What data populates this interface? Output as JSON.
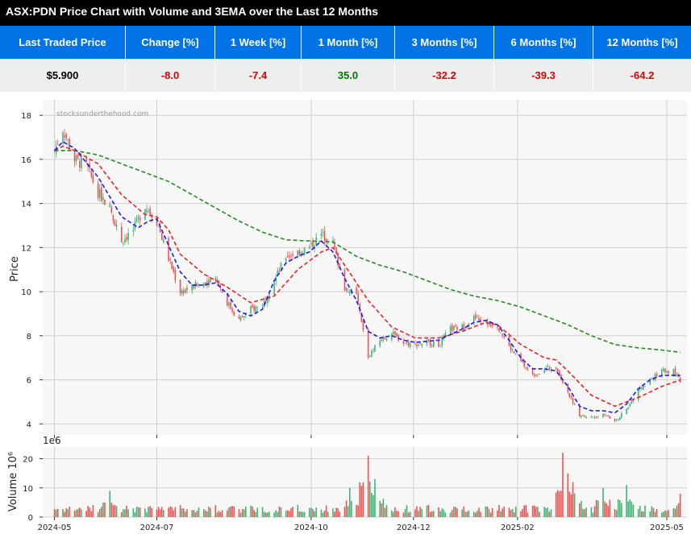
{
  "page": {
    "title": "ASX:PDN Price Chart with Volume and 3EMA over the Last 12 Months"
  },
  "stats": {
    "headers": [
      "Last Traded Price",
      "Change [%]",
      "1 Week [%]",
      "1 Month [%]",
      "3 Months [%]",
      "6 Months [%]",
      "12 Months [%]"
    ],
    "values": [
      "$5.900",
      "-8.0",
      "-7.4",
      "35.0",
      "-32.2",
      "-39.3",
      "-64.2"
    ],
    "value_colors": [
      "#000000",
      "#dd0000",
      "#dd0000",
      "#007700",
      "#dd0000",
      "#dd0000",
      "#dd0000"
    ]
  },
  "colors": {
    "up": "#3cb371",
    "down": "#f05050",
    "ema_fast": "#1a1aff",
    "ema_mid": "#ee2222",
    "ema_slow": "#228b22",
    "grid": "#d0d0d0",
    "header_bg": "#0073e6"
  },
  "chart_data": {
    "type": "candlestick",
    "watermark": "stocksunderthehood.com",
    "price_panel": {
      "ylabel": "Price",
      "ylim": [
        3.5,
        18.7
      ],
      "y_ticks": [
        4,
        6,
        8,
        10,
        12,
        14,
        16,
        18
      ],
      "grid": true
    },
    "volume_panel": {
      "ylabel": "Volume  10⁶",
      "offset_label": "1e6",
      "ylim": [
        0,
        24
      ],
      "y_ticks": [
        0,
        10,
        20
      ],
      "grid": true
    },
    "x_range": [
      "2024-04-24",
      "2025-05-13"
    ],
    "x_ticks": [
      "2024-05",
      "2024-07",
      "2024-10",
      "2024-12",
      "2025-02",
      "2025-05"
    ],
    "x_tick_dates": [
      "2024-05-01",
      "2024-07-01",
      "2024-10-01",
      "2024-12-01",
      "2025-02-01",
      "2025-05-01"
    ],
    "price_anchors": [
      [
        "2024-05-01",
        16.4
      ],
      [
        "2024-05-06",
        17.4
      ],
      [
        "2024-05-13",
        16.0
      ],
      [
        "2024-05-20",
        15.7
      ],
      [
        "2024-05-27",
        14.5
      ],
      [
        "2024-06-03",
        13.8
      ],
      [
        "2024-06-10",
        12.3
      ],
      [
        "2024-06-17",
        12.8
      ],
      [
        "2024-06-24",
        13.9
      ],
      [
        "2024-07-01",
        13.2
      ],
      [
        "2024-07-08",
        11.5
      ],
      [
        "2024-07-15",
        10.0
      ],
      [
        "2024-07-22",
        10.2
      ],
      [
        "2024-07-29",
        10.4
      ],
      [
        "2024-08-05",
        10.7
      ],
      [
        "2024-08-12",
        9.5
      ],
      [
        "2024-08-19",
        8.7
      ],
      [
        "2024-08-26",
        9.2
      ],
      [
        "2024-09-02",
        9.4
      ],
      [
        "2024-09-09",
        10.5
      ],
      [
        "2024-09-16",
        11.6
      ],
      [
        "2024-09-23",
        11.8
      ],
      [
        "2024-09-30",
        12.0
      ],
      [
        "2024-10-07",
        12.6
      ],
      [
        "2024-10-14",
        12.2
      ],
      [
        "2024-10-21",
        10.2
      ],
      [
        "2024-10-28",
        9.8
      ],
      [
        "2024-11-04",
        7.0
      ],
      [
        "2024-11-11",
        7.8
      ],
      [
        "2024-11-18",
        8.1
      ],
      [
        "2024-11-25",
        7.7
      ],
      [
        "2024-12-02",
        7.6
      ],
      [
        "2024-12-09",
        7.7
      ],
      [
        "2024-12-16",
        7.6
      ],
      [
        "2024-12-23",
        8.3
      ],
      [
        "2024-12-30",
        8.4
      ],
      [
        "2025-01-06",
        8.8
      ],
      [
        "2025-01-13",
        8.6
      ],
      [
        "2025-01-20",
        8.5
      ],
      [
        "2025-01-27",
        7.5
      ],
      [
        "2025-02-03",
        6.8
      ],
      [
        "2025-02-10",
        6.2
      ],
      [
        "2025-02-17",
        6.5
      ],
      [
        "2025-02-24",
        6.6
      ],
      [
        "2025-03-03",
        5.4
      ],
      [
        "2025-03-10",
        4.4
      ],
      [
        "2025-03-17",
        4.3
      ],
      [
        "2025-03-24",
        4.5
      ],
      [
        "2025-03-31",
        4.1
      ],
      [
        "2025-04-07",
        4.7
      ],
      [
        "2025-04-14",
        5.5
      ],
      [
        "2025-04-21",
        6.0
      ],
      [
        "2025-04-28",
        6.4
      ],
      [
        "2025-05-05",
        6.4
      ],
      [
        "2025-05-09",
        5.9
      ]
    ],
    "ema_fast": [
      [
        "2024-05-01",
        16.4
      ],
      [
        "2024-05-06",
        16.8
      ],
      [
        "2024-05-13",
        16.5
      ],
      [
        "2024-05-27",
        15.2
      ],
      [
        "2024-06-10",
        13.4
      ],
      [
        "2024-06-20",
        12.9
      ],
      [
        "2024-06-26",
        13.2
      ],
      [
        "2024-07-01",
        13.3
      ],
      [
        "2024-07-08",
        12.1
      ],
      [
        "2024-07-15",
        10.9
      ],
      [
        "2024-07-22",
        10.3
      ],
      [
        "2024-07-29",
        10.3
      ],
      [
        "2024-08-05",
        10.4
      ],
      [
        "2024-08-12",
        9.9
      ],
      [
        "2024-08-19",
        9.1
      ],
      [
        "2024-08-26",
        8.9
      ],
      [
        "2024-09-02",
        9.2
      ],
      [
        "2024-09-09",
        10.5
      ],
      [
        "2024-09-16",
        11.3
      ],
      [
        "2024-09-23",
        11.6
      ],
      [
        "2024-09-30",
        11.8
      ],
      [
        "2024-10-07",
        12.3
      ],
      [
        "2024-10-14",
        11.8
      ],
      [
        "2024-10-21",
        10.6
      ],
      [
        "2024-10-28",
        9.6
      ],
      [
        "2024-11-04",
        8.2
      ],
      [
        "2024-11-11",
        7.9
      ],
      [
        "2024-11-18",
        8.0
      ],
      [
        "2024-11-25",
        7.8
      ],
      [
        "2024-12-02",
        7.7
      ],
      [
        "2024-12-16",
        7.8
      ],
      [
        "2024-12-30",
        8.3
      ],
      [
        "2025-01-06",
        8.6
      ],
      [
        "2025-01-13",
        8.7
      ],
      [
        "2025-01-20",
        8.5
      ],
      [
        "2025-01-27",
        7.8
      ],
      [
        "2025-02-03",
        7.0
      ],
      [
        "2025-02-10",
        6.5
      ],
      [
        "2025-02-17",
        6.5
      ],
      [
        "2025-02-24",
        6.4
      ],
      [
        "2025-03-03",
        5.7
      ],
      [
        "2025-03-10",
        4.8
      ],
      [
        "2025-03-17",
        4.6
      ],
      [
        "2025-03-24",
        4.6
      ],
      [
        "2025-03-31",
        4.5
      ],
      [
        "2025-04-07",
        4.9
      ],
      [
        "2025-04-14",
        5.6
      ],
      [
        "2025-04-21",
        6.0
      ],
      [
        "2025-04-28",
        6.2
      ],
      [
        "2025-05-09",
        6.2
      ]
    ],
    "ema_mid": [
      [
        "2024-05-01",
        16.4
      ],
      [
        "2024-05-06",
        16.6
      ],
      [
        "2024-05-13",
        16.4
      ],
      [
        "2024-05-27",
        15.8
      ],
      [
        "2024-06-10",
        14.4
      ],
      [
        "2024-06-24",
        13.5
      ],
      [
        "2024-07-01",
        13.4
      ],
      [
        "2024-07-08",
        12.8
      ],
      [
        "2024-07-15",
        11.7
      ],
      [
        "2024-07-29",
        10.8
      ],
      [
        "2024-08-12",
        10.2
      ],
      [
        "2024-08-26",
        9.5
      ],
      [
        "2024-09-09",
        9.8
      ],
      [
        "2024-09-23",
        11.0
      ],
      [
        "2024-10-07",
        11.8
      ],
      [
        "2024-10-14",
        12.0
      ],
      [
        "2024-10-21",
        11.2
      ],
      [
        "2024-11-04",
        9.6
      ],
      [
        "2024-11-18",
        8.4
      ],
      [
        "2024-12-02",
        7.9
      ],
      [
        "2024-12-16",
        7.9
      ],
      [
        "2024-12-30",
        8.2
      ],
      [
        "2025-01-13",
        8.6
      ],
      [
        "2025-01-20",
        8.5
      ],
      [
        "2025-02-03",
        7.6
      ],
      [
        "2025-02-17",
        7.0
      ],
      [
        "2025-02-24",
        6.9
      ],
      [
        "2025-03-03",
        6.4
      ],
      [
        "2025-03-17",
        5.3
      ],
      [
        "2025-03-31",
        4.8
      ],
      [
        "2025-04-14",
        5.2
      ],
      [
        "2025-04-28",
        5.7
      ],
      [
        "2025-05-09",
        6.0
      ]
    ],
    "ema_slow": [
      [
        "2024-05-01",
        16.4
      ],
      [
        "2024-05-13",
        16.4
      ],
      [
        "2024-05-27",
        16.2
      ],
      [
        "2024-06-10",
        15.8
      ],
      [
        "2024-06-24",
        15.4
      ],
      [
        "2024-07-08",
        15.0
      ],
      [
        "2024-07-22",
        14.4
      ],
      [
        "2024-08-05",
        13.8
      ],
      [
        "2024-08-19",
        13.2
      ],
      [
        "2024-09-02",
        12.7
      ],
      [
        "2024-09-16",
        12.35
      ],
      [
        "2024-09-30",
        12.3
      ],
      [
        "2024-10-14",
        12.25
      ],
      [
        "2024-10-28",
        11.6
      ],
      [
        "2024-11-11",
        11.2
      ],
      [
        "2024-11-25",
        10.9
      ],
      [
        "2024-12-09",
        10.5
      ],
      [
        "2024-12-23",
        10.1
      ],
      [
        "2025-01-06",
        9.8
      ],
      [
        "2025-01-20",
        9.6
      ],
      [
        "2025-02-03",
        9.3
      ],
      [
        "2025-02-17",
        8.9
      ],
      [
        "2025-03-03",
        8.5
      ],
      [
        "2025-03-17",
        8.0
      ],
      [
        "2025-03-31",
        7.6
      ],
      [
        "2025-04-14",
        7.45
      ],
      [
        "2025-04-28",
        7.35
      ],
      [
        "2025-05-09",
        7.25
      ]
    ],
    "volume_spikes": [
      [
        "2024-06-03",
        9
      ],
      [
        "2024-10-24",
        10
      ],
      [
        "2024-11-04",
        21
      ],
      [
        "2024-11-08",
        13
      ],
      [
        "2025-02-28",
        22
      ],
      [
        "2025-03-03",
        15
      ],
      [
        "2025-03-06",
        12
      ],
      [
        "2025-03-24",
        10
      ],
      [
        "2025-04-07",
        11
      ],
      [
        "2025-05-09",
        8
      ]
    ],
    "volume_base": 3
  }
}
